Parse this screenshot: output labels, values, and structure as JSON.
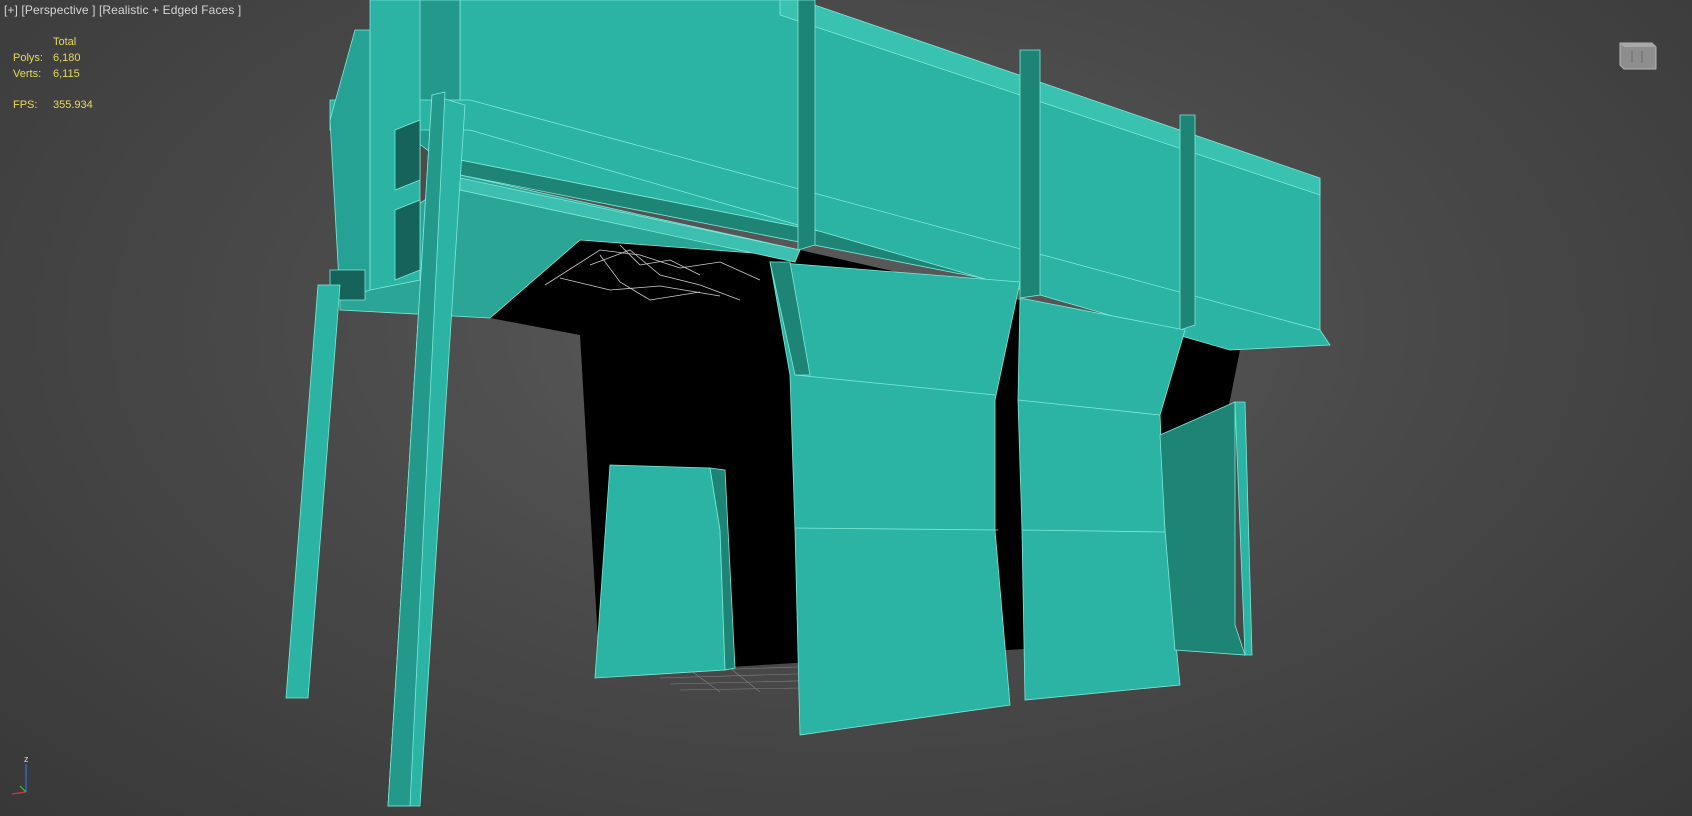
{
  "viewport": {
    "label_parts": [
      "[+]",
      "[Perspective ]",
      "[Realistic + Edged Faces ]"
    ]
  },
  "stats": {
    "header": "Total",
    "polys_label": "Polys:",
    "polys_value": "6,180",
    "verts_label": "Verts:",
    "verts_value": "6,115",
    "fps_label": "FPS:",
    "fps_value": "355.934"
  },
  "axis": {
    "z_label": "z"
  },
  "colors": {
    "mesh": "#2bb3a3",
    "mesh_dark": "#1e8476",
    "mesh_shadow": "#15635a",
    "edges": "#7fe9da",
    "void": "#000000",
    "stats_text": "#e8d95a",
    "label_text": "#d6d6d6"
  },
  "icons": [
    "viewcube-icon",
    "axis-tripod-icon"
  ]
}
